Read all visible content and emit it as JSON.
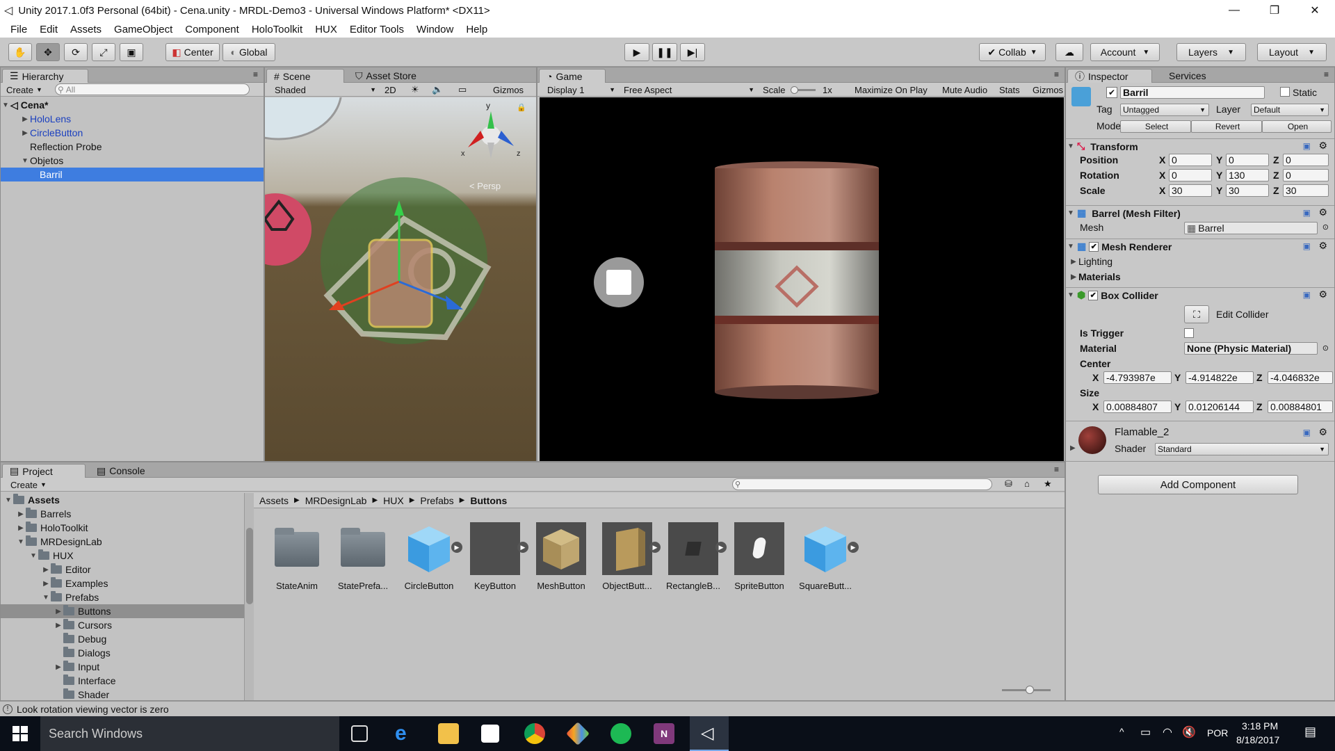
{
  "window": {
    "title": "Unity 2017.1.0f3 Personal (64bit) - Cena.unity - MRDL-Demo3 - Universal Windows Platform* <DX11>",
    "controls": [
      "—",
      "❐",
      "✕"
    ]
  },
  "menu": [
    "File",
    "Edit",
    "Assets",
    "GameObject",
    "Component",
    "HoloToolkit",
    "HUX",
    "Editor Tools",
    "Window",
    "Help"
  ],
  "toolbar": {
    "pivot": "Center",
    "space": "Global",
    "collab": "Collab",
    "account": "Account",
    "layers": "Layers",
    "layout": "Layout"
  },
  "hierarchy": {
    "tab": "Hierarchy",
    "create": "Create",
    "search_placeholder": "All",
    "scene": "Cena*",
    "items": [
      {
        "label": "HoloLens",
        "indent": 1,
        "arrow": "▶",
        "prefab": true,
        "selected": false
      },
      {
        "label": "CircleButton",
        "indent": 1,
        "arrow": "▶",
        "prefab": true,
        "selected": false
      },
      {
        "label": "Reflection Probe",
        "indent": 1,
        "arrow": "",
        "prefab": false,
        "selected": false
      },
      {
        "label": "Objetos",
        "indent": 1,
        "arrow": "▼",
        "prefab": false,
        "selected": false
      },
      {
        "label": "Barril",
        "indent": 2,
        "arrow": "",
        "prefab": false,
        "selected": true
      }
    ]
  },
  "scene": {
    "tab": "Scene",
    "tab2": "Asset Store",
    "shading": "Shaded",
    "mode2d": "2D",
    "gizmos": "Gizmos",
    "persp": "< Persp",
    "axes": {
      "x": "x",
      "y": "y",
      "z": "z"
    }
  },
  "game": {
    "tab": "Game",
    "display": "Display 1",
    "aspect": "Free Aspect",
    "scale_label": "Scale",
    "scale_value": "1x",
    "maximize": "Maximize On Play",
    "mute": "Mute Audio",
    "stats": "Stats",
    "gizmos": "Gizmos"
  },
  "inspector": {
    "tab": "Inspector",
    "tab2": "Services",
    "object_name": "Barril",
    "static_label": "Static",
    "tag_label": "Tag",
    "tag_value": "Untagged",
    "layer_label": "Layer",
    "layer_value": "Default",
    "model_label": "Model",
    "model_buttons": [
      "Select",
      "Revert",
      "Open"
    ],
    "transform": {
      "title": "Transform",
      "rows": [
        {
          "label": "Position",
          "x": "0",
          "y": "0",
          "z": "0"
        },
        {
          "label": "Rotation",
          "x": "0",
          "y": "130",
          "z": "0"
        },
        {
          "label": "Scale",
          "x": "30",
          "y": "30",
          "z": "30"
        }
      ]
    },
    "mesh_filter": {
      "title": "Barrel (Mesh Filter)",
      "mesh_label": "Mesh",
      "mesh_value": "Barrel"
    },
    "mesh_renderer": {
      "title": "Mesh Renderer",
      "lighting": "Lighting",
      "materials": "Materials"
    },
    "box_collider": {
      "title": "Box Collider",
      "edit": "Edit Collider",
      "is_trigger": "Is Trigger",
      "material_label": "Material",
      "material_value": "None (Physic Material)",
      "center_label": "Center",
      "center": {
        "x": "-4.793987e",
        "y": "-4.914822e",
        "z": "-4.046832e"
      },
      "size_label": "Size",
      "size": {
        "x": "0.00884807",
        "y": "0.01206144",
        "z": "0.00884801"
      }
    },
    "material": {
      "name": "Flamable_2",
      "shader_label": "Shader",
      "shader_value": "Standard"
    },
    "add_component": "Add Component"
  },
  "project": {
    "tab": "Project",
    "tab2": "Console",
    "create": "Create",
    "tree": [
      {
        "label": "Assets",
        "indent": 0,
        "arrow": "▼",
        "bold": true,
        "selected": false
      },
      {
        "label": "Barrels",
        "indent": 1,
        "arrow": "▶",
        "bold": false,
        "selected": false
      },
      {
        "label": "HoloToolkit",
        "indent": 1,
        "arrow": "▶",
        "bold": false,
        "selected": false
      },
      {
        "label": "MRDesignLab",
        "indent": 1,
        "arrow": "▼",
        "bold": false,
        "selected": false
      },
      {
        "label": "HUX",
        "indent": 2,
        "arrow": "▼",
        "bold": false,
        "selected": false
      },
      {
        "label": "Editor",
        "indent": 3,
        "arrow": "▶",
        "bold": false,
        "selected": false
      },
      {
        "label": "Examples",
        "indent": 3,
        "arrow": "▶",
        "bold": false,
        "selected": false
      },
      {
        "label": "Prefabs",
        "indent": 3,
        "arrow": "▼",
        "bold": false,
        "selected": false
      },
      {
        "label": "Buttons",
        "indent": 4,
        "arrow": "▶",
        "bold": false,
        "selected": true
      },
      {
        "label": "Cursors",
        "indent": 4,
        "arrow": "▶",
        "bold": false,
        "selected": false
      },
      {
        "label": "Debug",
        "indent": 4,
        "arrow": "",
        "bold": false,
        "selected": false
      },
      {
        "label": "Dialogs",
        "indent": 4,
        "arrow": "",
        "bold": false,
        "selected": false
      },
      {
        "label": "Input",
        "indent": 4,
        "arrow": "▶",
        "bold": false,
        "selected": false
      },
      {
        "label": "Interface",
        "indent": 4,
        "arrow": "",
        "bold": false,
        "selected": false
      },
      {
        "label": "Shader",
        "indent": 4,
        "arrow": "",
        "bold": false,
        "selected": false
      }
    ],
    "breadcrumb": [
      "Assets",
      "MRDesignLab",
      "HUX",
      "Prefabs",
      "Buttons"
    ],
    "assets": [
      {
        "label": "StateAnim",
        "kind": "folder"
      },
      {
        "label": "StatePrefa...",
        "kind": "folder"
      },
      {
        "label": "CircleButton",
        "kind": "cube-blue"
      },
      {
        "label": "KeyButton",
        "kind": "dark"
      },
      {
        "label": "MeshButton",
        "kind": "cube-tan"
      },
      {
        "label": "ObjectButt...",
        "kind": "box-tan"
      },
      {
        "label": "RectangleB...",
        "kind": "dark2"
      },
      {
        "label": "SpriteButton",
        "kind": "sprite"
      },
      {
        "label": "SquareButt...",
        "kind": "cube-blue"
      }
    ]
  },
  "status": {
    "message": "Look rotation viewing vector is zero"
  },
  "taskbar": {
    "search": "Search Windows",
    "lang": "POR",
    "time": "3:18 PM",
    "date": "8/18/2017"
  }
}
